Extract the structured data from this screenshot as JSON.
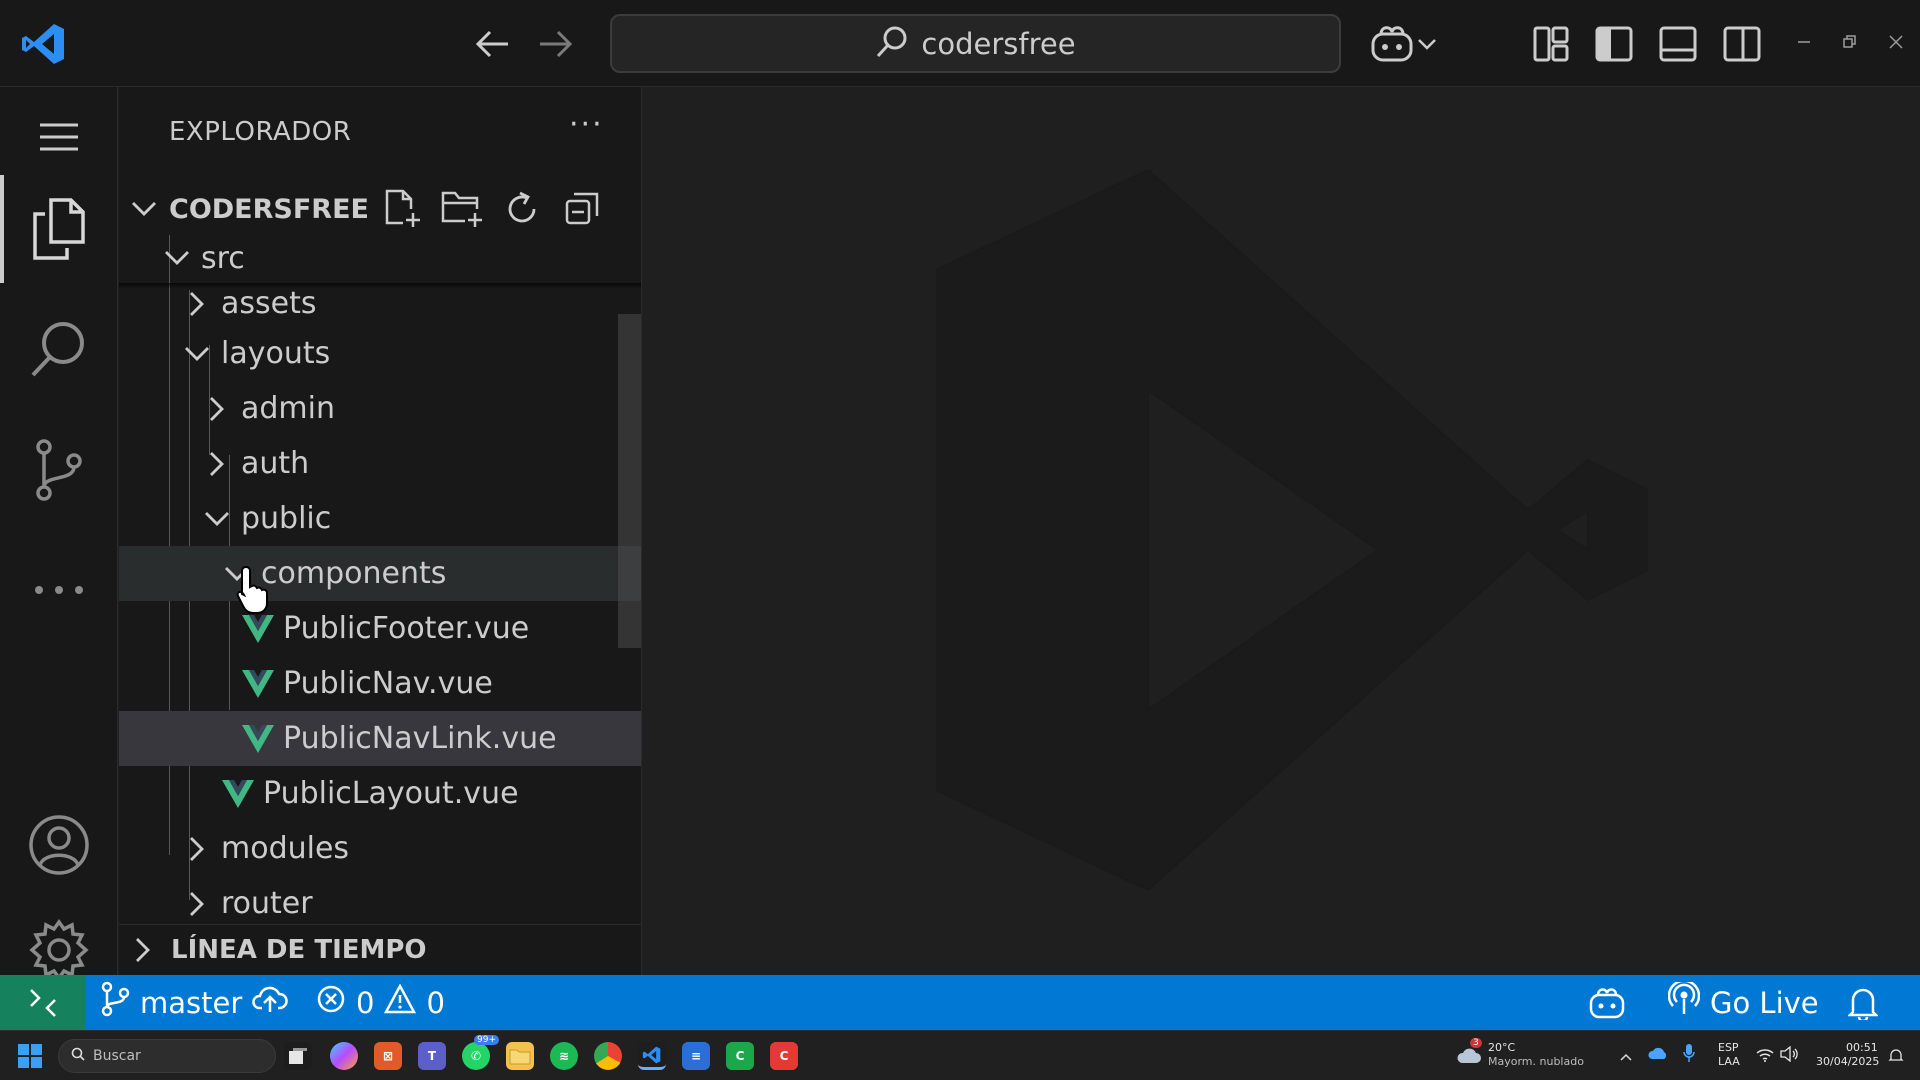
{
  "titlebar": {
    "search_text": "codersfree"
  },
  "sidebar": {
    "title": "EXPLORADOR",
    "more": "···",
    "folder_name": "CODERSFREE",
    "timeline_label": "LÍNEA DE TIEMPO",
    "tree": [
      {
        "label": "src",
        "type": "folder",
        "expanded": true,
        "depth": 0
      },
      {
        "label": "assets",
        "type": "folder",
        "expanded": false,
        "depth": 1
      },
      {
        "label": "layouts",
        "type": "folder",
        "expanded": true,
        "depth": 1
      },
      {
        "label": "admin",
        "type": "folder",
        "expanded": false,
        "depth": 2
      },
      {
        "label": "auth",
        "type": "folder",
        "expanded": false,
        "depth": 2
      },
      {
        "label": "public",
        "type": "folder",
        "expanded": true,
        "depth": 2
      },
      {
        "label": "components",
        "type": "folder",
        "expanded": true,
        "depth": 3
      },
      {
        "label": "PublicFooter.vue",
        "type": "vue",
        "depth": 4
      },
      {
        "label": "PublicNav.vue",
        "type": "vue",
        "depth": 4
      },
      {
        "label": "PublicNavLink.vue",
        "type": "vue",
        "depth": 4
      },
      {
        "label": "PublicLayout.vue",
        "type": "vue",
        "depth": 3
      },
      {
        "label": "modules",
        "type": "folder",
        "expanded": false,
        "depth": 1
      },
      {
        "label": "router",
        "type": "folder",
        "expanded": false,
        "depth": 1
      }
    ]
  },
  "statusbar": {
    "branch": "master",
    "errors": "0",
    "warnings": "0",
    "go_live": "Go Live"
  },
  "taskbar": {
    "search_placeholder": "Buscar",
    "whatsapp_badge": "99+",
    "weather_badge": "3",
    "weather_temp": "20°C",
    "weather_desc": "Mayorm. nublado",
    "lang_top": "ESP",
    "lang_bottom": "LAA",
    "time": "00:51",
    "date": "30/04/2025"
  },
  "colors": {
    "accent": "#0078d4",
    "remote": "#16825d",
    "vue_green": "#41b883"
  }
}
